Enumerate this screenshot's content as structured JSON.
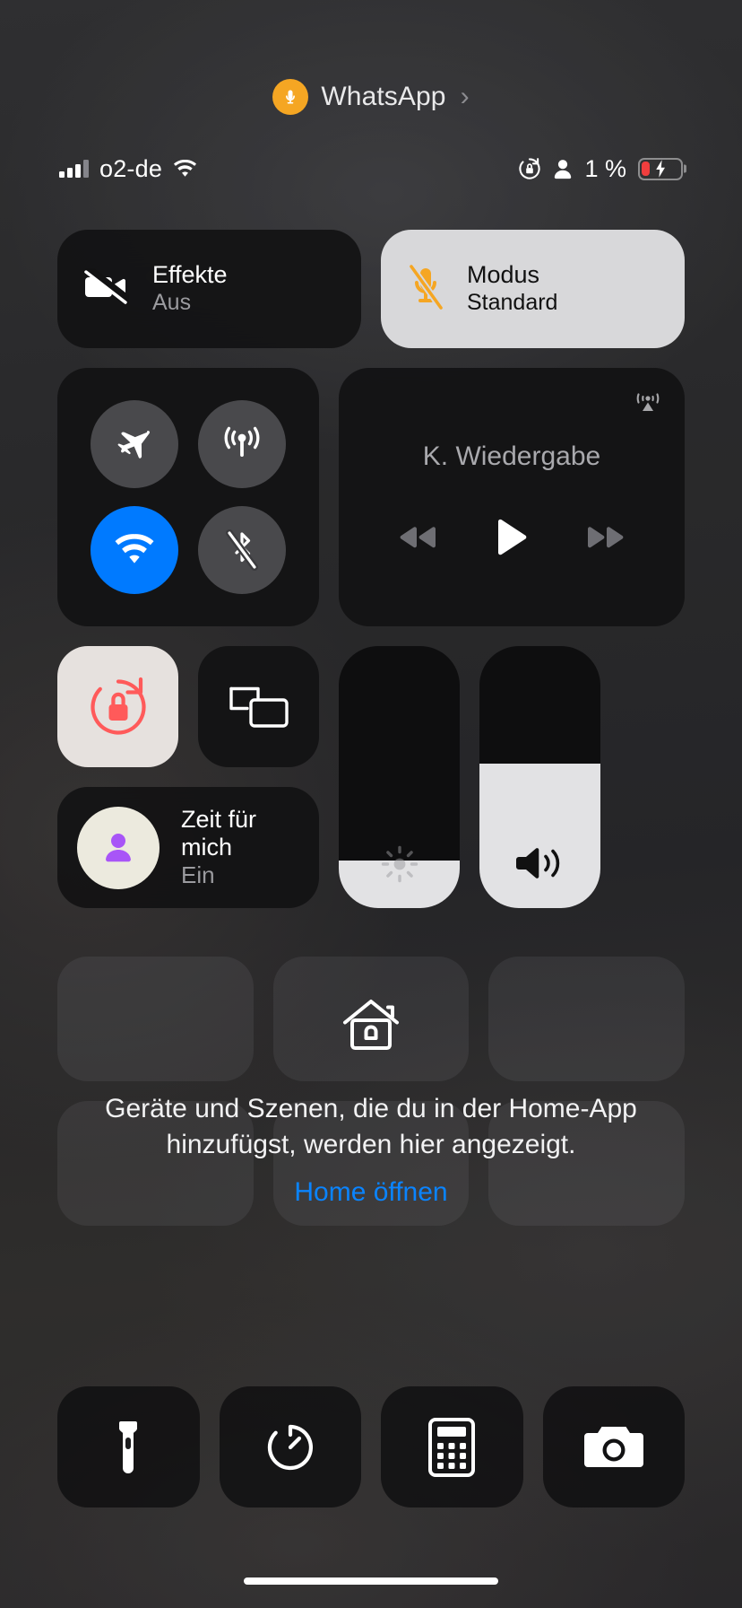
{
  "call_banner": {
    "app_name": "WhatsApp",
    "icon": "microphone-icon",
    "chevron": "›",
    "badge_color": "#F5A623"
  },
  "status_bar": {
    "carrier": "o2-de",
    "signal_icon": "cellular-bars-icon",
    "wifi_icon": "wifi-icon",
    "rotation_lock_icon": "rotation-lock-icon",
    "person_icon": "person-icon",
    "battery_percent": "1 %",
    "battery_icon": "battery-charging-icon",
    "battery_level": 1,
    "battery_color": "#F03E3E"
  },
  "tiles": {
    "effects": {
      "title": "Effekte",
      "subtitle": "Aus",
      "icon": "video-slash-icon"
    },
    "mode": {
      "title": "Modus",
      "subtitle": "Standard",
      "icon": "microphone-slash-icon",
      "icon_color": "#F5A623"
    }
  },
  "connectivity": {
    "items": [
      {
        "name": "airplane-mode",
        "icon": "airplane-icon",
        "active": false
      },
      {
        "name": "cellular-data",
        "icon": "cellular-antenna-icon",
        "active": false
      },
      {
        "name": "wifi",
        "icon": "wifi-icon",
        "active": true
      },
      {
        "name": "bluetooth",
        "icon": "bluetooth-slash-icon",
        "active": false
      }
    ],
    "active_color": "#007AFF"
  },
  "media": {
    "title": "K. Wiedergabe",
    "airplay_icon": "airplay-audio-icon",
    "controls": [
      {
        "name": "rewind-button",
        "icon": "rewind-icon"
      },
      {
        "name": "play-button",
        "icon": "play-icon"
      },
      {
        "name": "fast-forward-button",
        "icon": "fast-forward-icon"
      }
    ]
  },
  "toggles": {
    "orientation_lock": {
      "icon": "rotation-lock-icon",
      "active": true,
      "icon_color": "#FF5A5A"
    },
    "screen_mirroring": {
      "icon": "screen-mirroring-icon",
      "active": false
    }
  },
  "focus": {
    "title_line1": "Zeit für",
    "title_line2": "mich",
    "subtitle": "Ein",
    "icon": "person-icon",
    "icon_color": "#A855F7"
  },
  "sliders": {
    "brightness": {
      "name": "brightness-slider",
      "icon": "brightness-icon",
      "value": 18
    },
    "volume": {
      "name": "volume-slider",
      "icon": "speaker-waves-icon",
      "value": 55
    }
  },
  "home_card": {
    "icon": "home-icon",
    "description": "Geräte und Szenen, die du in der Home-App hinzufügst, werden hier angezeigt.",
    "link_label": "Home öffnen",
    "link_color": "#0A84FF"
  },
  "utilities": [
    {
      "name": "flashlight-button",
      "icon": "flashlight-icon"
    },
    {
      "name": "timer-button",
      "icon": "timer-icon"
    },
    {
      "name": "calculator-button",
      "icon": "calculator-icon"
    },
    {
      "name": "camera-button",
      "icon": "camera-icon"
    }
  ]
}
